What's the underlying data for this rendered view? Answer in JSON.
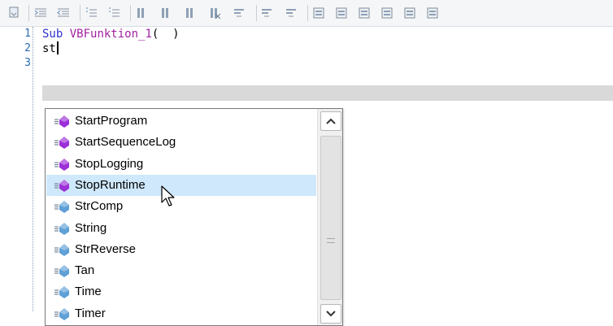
{
  "editor": {
    "lines": [
      {
        "number": "1",
        "keyword": "Sub",
        "name": "VBFunktion_1",
        "rest": "(  )"
      },
      {
        "number": "2",
        "text": "st"
      },
      {
        "number": "3",
        "text": ""
      }
    ]
  },
  "toolbar": {
    "icons": [
      "comment-macro-icon",
      "indent-icon",
      "outdent-icon",
      "comment-lines-icon",
      "uncomment-lines-icon",
      "toggle-bookmark-icon",
      "previous-bookmark-icon",
      "next-bookmark-icon",
      "clear-bookmarks-icon",
      "format-icon",
      "parameter-info-icon",
      "quick-info-icon",
      "object-browser-icon",
      "window-1-icon",
      "window-2-icon",
      "window-3-icon",
      "window-4-icon",
      "window-5-icon"
    ]
  },
  "completion": {
    "items": [
      {
        "label": "StartProgram",
        "kind": "method",
        "selected": false
      },
      {
        "label": "StartSequenceLog",
        "kind": "method",
        "selected": false
      },
      {
        "label": "StopLogging",
        "kind": "method",
        "selected": false
      },
      {
        "label": "StopRuntime",
        "kind": "method",
        "selected": true
      },
      {
        "label": "StrComp",
        "kind": "function",
        "selected": false
      },
      {
        "label": "String",
        "kind": "function",
        "selected": false
      },
      {
        "label": "StrReverse",
        "kind": "function",
        "selected": false
      },
      {
        "label": "Tan",
        "kind": "function",
        "selected": false
      },
      {
        "label": "Time",
        "kind": "function",
        "selected": false
      },
      {
        "label": "Timer",
        "kind": "function",
        "selected": false
      }
    ],
    "scroll_fraction": 0.85
  },
  "colors": {
    "keyword": "#2f2fcf",
    "identifier": "#a020a0",
    "selection": "#cfe8fb",
    "method_icon": "#9b30d8",
    "function_icon": "#5fa0d6"
  }
}
